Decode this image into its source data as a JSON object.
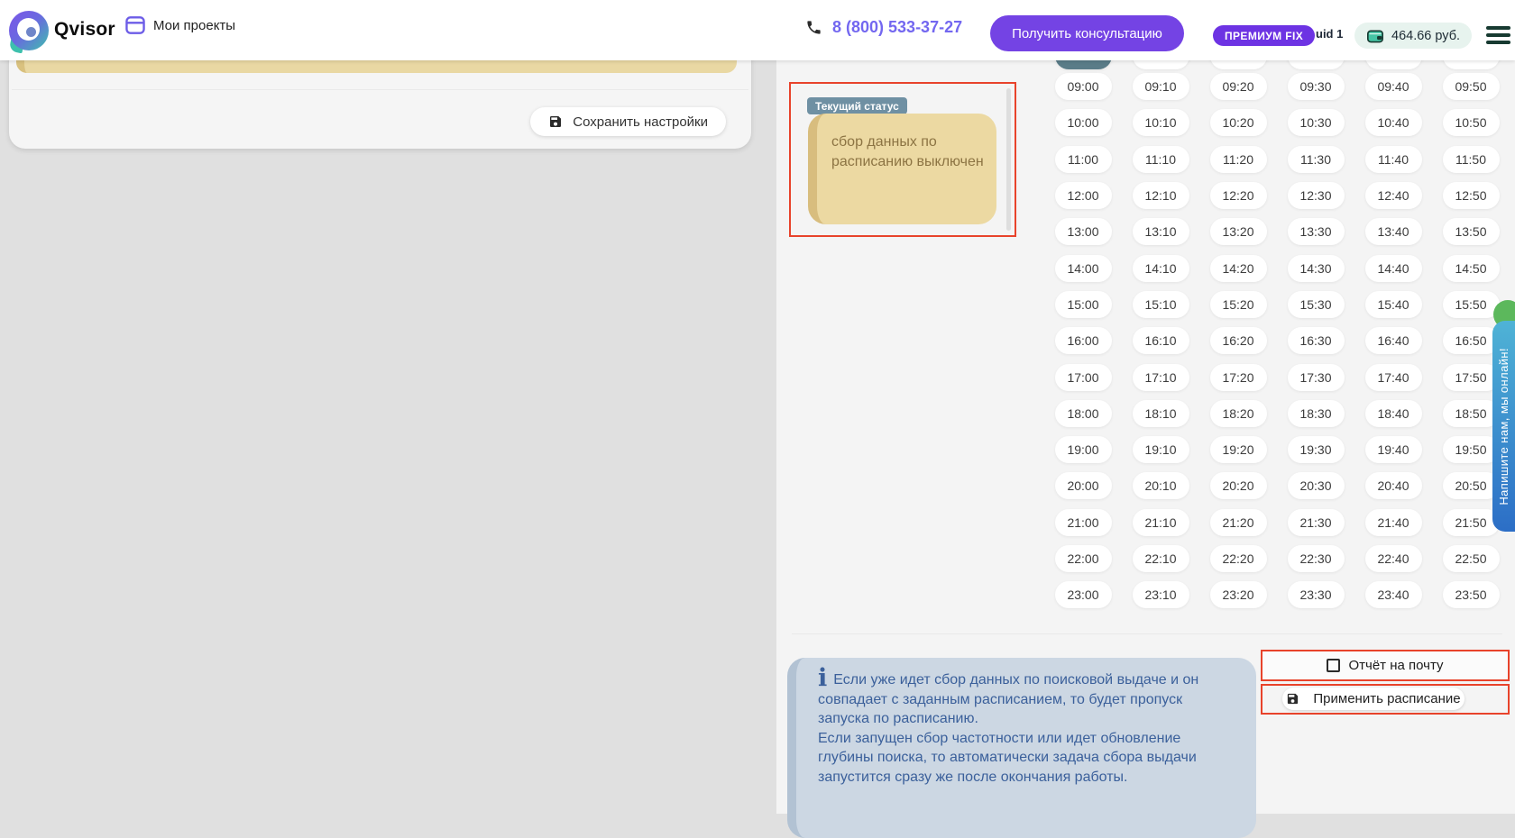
{
  "header": {
    "brand": "Qvisor",
    "projects_label": "Мои проекты",
    "phone": "8 (800) 533-37-27",
    "consult_button": "Получить консультацию",
    "premium_badge": "ПРЕМИУМ FIX",
    "uid_label": "uid 1",
    "balance": "464.66 руб."
  },
  "settings_panel": {
    "save_button": "Сохранить настройки"
  },
  "status_panel": {
    "badge": "Текущий статус",
    "status_text": "сбор данных по расписанию выключен"
  },
  "schedule": {
    "times": [
      [
        "09:00",
        "09:10",
        "09:20",
        "09:30",
        "09:40",
        "09:50"
      ],
      [
        "10:00",
        "10:10",
        "10:20",
        "10:30",
        "10:40",
        "10:50"
      ],
      [
        "11:00",
        "11:10",
        "11:20",
        "11:30",
        "11:40",
        "11:50"
      ],
      [
        "12:00",
        "12:10",
        "12:20",
        "12:30",
        "12:40",
        "12:50"
      ],
      [
        "13:00",
        "13:10",
        "13:20",
        "13:30",
        "13:40",
        "13:50"
      ],
      [
        "14:00",
        "14:10",
        "14:20",
        "14:30",
        "14:40",
        "14:50"
      ],
      [
        "15:00",
        "15:10",
        "15:20",
        "15:30",
        "15:40",
        "15:50"
      ],
      [
        "16:00",
        "16:10",
        "16:20",
        "16:30",
        "16:40",
        "16:50"
      ],
      [
        "17:00",
        "17:10",
        "17:20",
        "17:30",
        "17:40",
        "17:50"
      ],
      [
        "18:00",
        "18:10",
        "18:20",
        "18:30",
        "18:40",
        "18:50"
      ],
      [
        "19:00",
        "19:10",
        "19:20",
        "19:30",
        "19:40",
        "19:50"
      ],
      [
        "20:00",
        "20:10",
        "20:20",
        "20:30",
        "20:40",
        "20:50"
      ],
      [
        "21:00",
        "21:10",
        "21:20",
        "21:30",
        "21:40",
        "21:50"
      ],
      [
        "22:00",
        "22:10",
        "22:20",
        "22:30",
        "22:40",
        "22:50"
      ],
      [
        "23:00",
        "23:10",
        "23:20",
        "23:30",
        "23:40",
        "23:50"
      ]
    ]
  },
  "schedule_actions": {
    "report_checkbox_label": "Отчёт на почту",
    "report_checked": false,
    "apply_button": "Применить расписание"
  },
  "info_note": {
    "p1": "Если уже идет сбор данных по поисковой выдаче и он совпадает с заданным расписанием, то будет пропуск запуска по расписанию.",
    "p2": "Если запущен сбор частотности или идет обновление глубины поиска, то автоматически задача сбора выдачи запустится сразу же после окончания работы."
  },
  "chat_widget": {
    "label": "Напишите нам, мы онлайн!"
  },
  "colors": {
    "accent_purple": "#7443e4",
    "highlight_red": "#e8432b",
    "status_tan": "#ecd9a2",
    "status_badge_slate": "#6f90a3",
    "selected_time_pill": "#5a7c88",
    "info_bg": "#ccd7e3",
    "info_text": "#3b609b",
    "balance_bg": "#e7f3ee",
    "wallet_teal": "#45c4a4",
    "chat_gradient_top": "#4fb3d6",
    "chat_gradient_bottom": "#2c6ec6",
    "chat_green": "#5cb85c"
  }
}
